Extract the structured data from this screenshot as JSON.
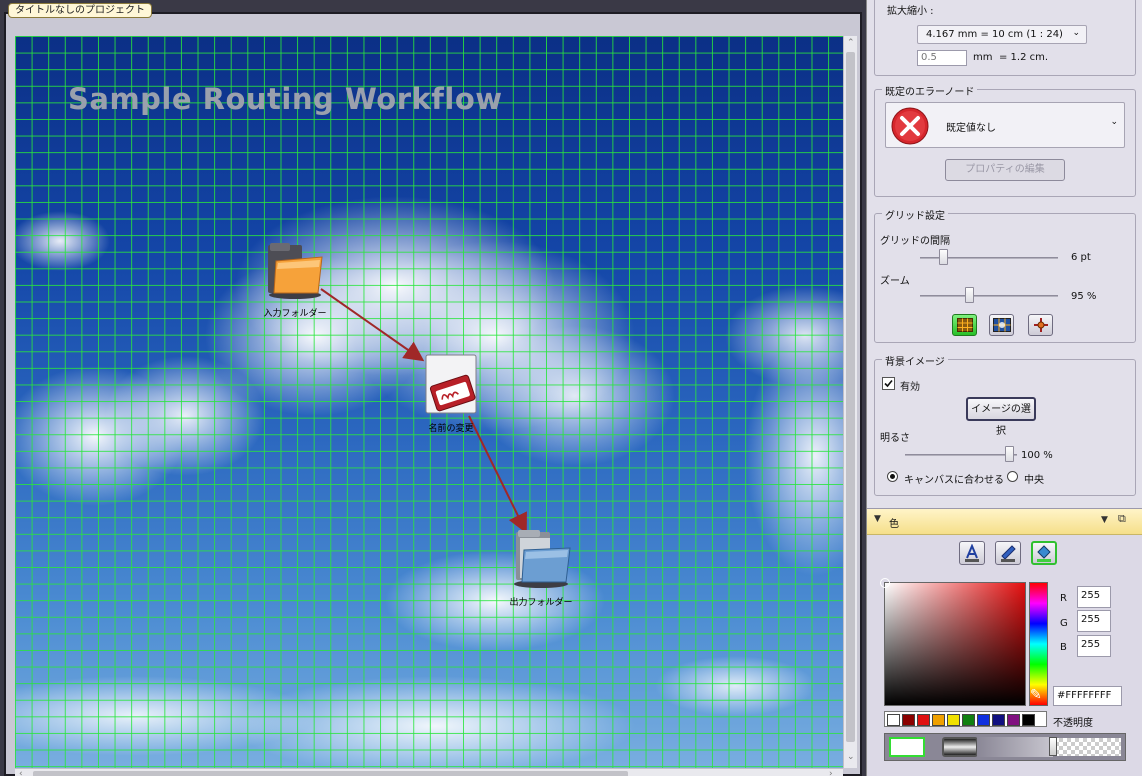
{
  "document": {
    "tab_title": "タイトルなしのプロジェクト",
    "canvas_title": "Sample Routing Workflow"
  },
  "nodes": [
    {
      "id": "input-folder",
      "label": "入力フォルダー",
      "icon": "orange-folder-icon"
    },
    {
      "id": "rename",
      "label": "名前の変更",
      "icon": "rename-tag-icon"
    },
    {
      "id": "output-folder",
      "label": "出力フォルダー",
      "icon": "blue-folder-icon"
    }
  ],
  "panel": {
    "zoom_section": {
      "label": "拡大縮小 :",
      "scale_value": "4.167 mm = 10 cm (1 : 24)",
      "mm_value": "0.5",
      "mm_unit": "mm",
      "equals_text": "=  1.2 cm."
    },
    "error_node": {
      "title": "既定のエラーノード",
      "value": "既定値なし",
      "properties_button": "プロパティの編集"
    },
    "grid": {
      "title": "グリッド設定",
      "spacing_label": "グリッドの間隔",
      "spacing_value": "6 pt",
      "zoom_label": "ズーム",
      "zoom_value": "95 %",
      "icons": [
        "grid-icon",
        "grid-image-icon",
        "snap-crosshair-icon"
      ],
      "accent_color": "#3cdc3c"
    },
    "background": {
      "title": "背景イメージ",
      "enabled_label": "有効",
      "enabled": true,
      "select_button": "イメージの選択",
      "brightness_label": "明るさ",
      "brightness_value": "100 %",
      "fit_label": "キャンバスに合わせる",
      "center_label": "中央",
      "fit_selected": true
    },
    "color": {
      "title": "色",
      "r_label": "R",
      "r": "255",
      "g_label": "G",
      "g": "255",
      "b_label": "B",
      "b": "255",
      "hex": "#FFFFFFFF",
      "opacity_label": "不透明度",
      "swatches": [
        "#ffffff",
        "#8b0000",
        "#e01010",
        "#f0a000",
        "#f0e000",
        "#108010",
        "#1030e0",
        "#101080",
        "#801080",
        "#000000"
      ]
    }
  }
}
